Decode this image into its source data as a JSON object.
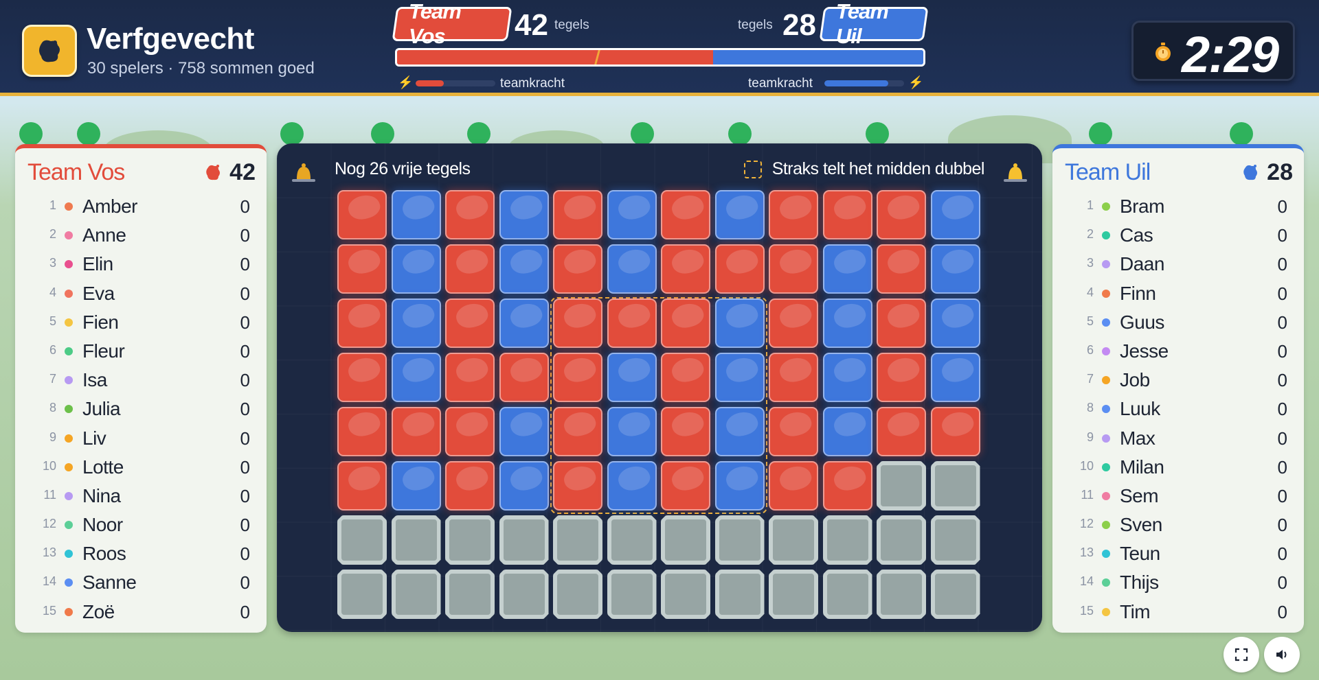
{
  "app": {
    "title": "Verfgevecht",
    "subtitle": "30 spelers · 758 sommen goed"
  },
  "teams": {
    "vos": {
      "name": "Team Vos",
      "tiles": 42,
      "unit": "tegels",
      "power_label": "teamkracht",
      "power": 0.35,
      "color": "#e24c3b"
    },
    "uil": {
      "name": "Team Uil",
      "tiles": 28,
      "unit": "tegels",
      "power_label": "teamkracht",
      "power": 0.8,
      "color": "#3e77dc"
    }
  },
  "paint_share": {
    "vos": 0.6,
    "uil": 0.4
  },
  "timer": "2:29",
  "board": {
    "free_tiles_text": "Nog 26 vrije tegels",
    "hint_text": "Straks telt het midden dubbel",
    "grid": [
      "RBRBRBRBRRRB",
      "RBRBRBRRRBRB",
      "RBRBRRRBRBRB",
      "RBRRRBRBRBRB",
      "RRRBRBRBRBRR",
      "RBRBRBRBRREE",
      "EEEEEEEEEEEE",
      "EEEEEEEEEEEE"
    ]
  },
  "left_panel": {
    "name": "Team Vos",
    "score": "42",
    "players": [
      {
        "rank": "1",
        "name": "Amber",
        "score": "0",
        "dot": "#ef7a4f"
      },
      {
        "rank": "2",
        "name": "Anne",
        "score": "0",
        "dot": "#f07ca2"
      },
      {
        "rank": "3",
        "name": "Elin",
        "score": "0",
        "dot": "#e9508f"
      },
      {
        "rank": "4",
        "name": "Eva",
        "score": "0",
        "dot": "#f0745e"
      },
      {
        "rank": "5",
        "name": "Fien",
        "score": "0",
        "dot": "#f4c542"
      },
      {
        "rank": "6",
        "name": "Fleur",
        "score": "0",
        "dot": "#4ccb86"
      },
      {
        "rank": "7",
        "name": "Isa",
        "score": "0",
        "dot": "#b79af2"
      },
      {
        "rank": "8",
        "name": "Julia",
        "score": "0",
        "dot": "#6cc04a"
      },
      {
        "rank": "9",
        "name": "Liv",
        "score": "0",
        "dot": "#f5a524"
      },
      {
        "rank": "10",
        "name": "Lotte",
        "score": "0",
        "dot": "#f5a524"
      },
      {
        "rank": "11",
        "name": "Nina",
        "score": "0",
        "dot": "#b79af2"
      },
      {
        "rank": "12",
        "name": "Noor",
        "score": "0",
        "dot": "#5ccf97"
      },
      {
        "rank": "13",
        "name": "Roos",
        "score": "0",
        "dot": "#30c3d6"
      },
      {
        "rank": "14",
        "name": "Sanne",
        "score": "0",
        "dot": "#5b8ef2"
      },
      {
        "rank": "15",
        "name": "Zoë",
        "score": "0",
        "dot": "#f07a4a"
      }
    ]
  },
  "right_panel": {
    "name": "Team Uil",
    "score": "28",
    "players": [
      {
        "rank": "1",
        "name": "Bram",
        "score": "0",
        "dot": "#8ccf4a"
      },
      {
        "rank": "2",
        "name": "Cas",
        "score": "0",
        "dot": "#2ecaa0"
      },
      {
        "rank": "3",
        "name": "Daan",
        "score": "0",
        "dot": "#b79af2"
      },
      {
        "rank": "4",
        "name": "Finn",
        "score": "0",
        "dot": "#f07a4a"
      },
      {
        "rank": "5",
        "name": "Guus",
        "score": "0",
        "dot": "#5b8ef2"
      },
      {
        "rank": "6",
        "name": "Jesse",
        "score": "0",
        "dot": "#c38af2"
      },
      {
        "rank": "7",
        "name": "Job",
        "score": "0",
        "dot": "#f5a524"
      },
      {
        "rank": "8",
        "name": "Luuk",
        "score": "0",
        "dot": "#5b8ef2"
      },
      {
        "rank": "9",
        "name": "Max",
        "score": "0",
        "dot": "#b79af2"
      },
      {
        "rank": "10",
        "name": "Milan",
        "score": "0",
        "dot": "#2ecaa0"
      },
      {
        "rank": "11",
        "name": "Sem",
        "score": "0",
        "dot": "#f07ca2"
      },
      {
        "rank": "12",
        "name": "Sven",
        "score": "0",
        "dot": "#8ccf4a"
      },
      {
        "rank": "13",
        "name": "Teun",
        "score": "0",
        "dot": "#30c3d6"
      },
      {
        "rank": "14",
        "name": "Thijs",
        "score": "0",
        "dot": "#5ccf97"
      },
      {
        "rank": "15",
        "name": "Tim",
        "score": "0",
        "dot": "#f4c542"
      }
    ]
  },
  "icons": {
    "logo": "paint-blob-icon",
    "timer": "stopwatch-icon",
    "bell": "bell-icon",
    "power": "lightning-icon",
    "fullscreen": "fullscreen-icon",
    "sound": "speaker-icon"
  }
}
